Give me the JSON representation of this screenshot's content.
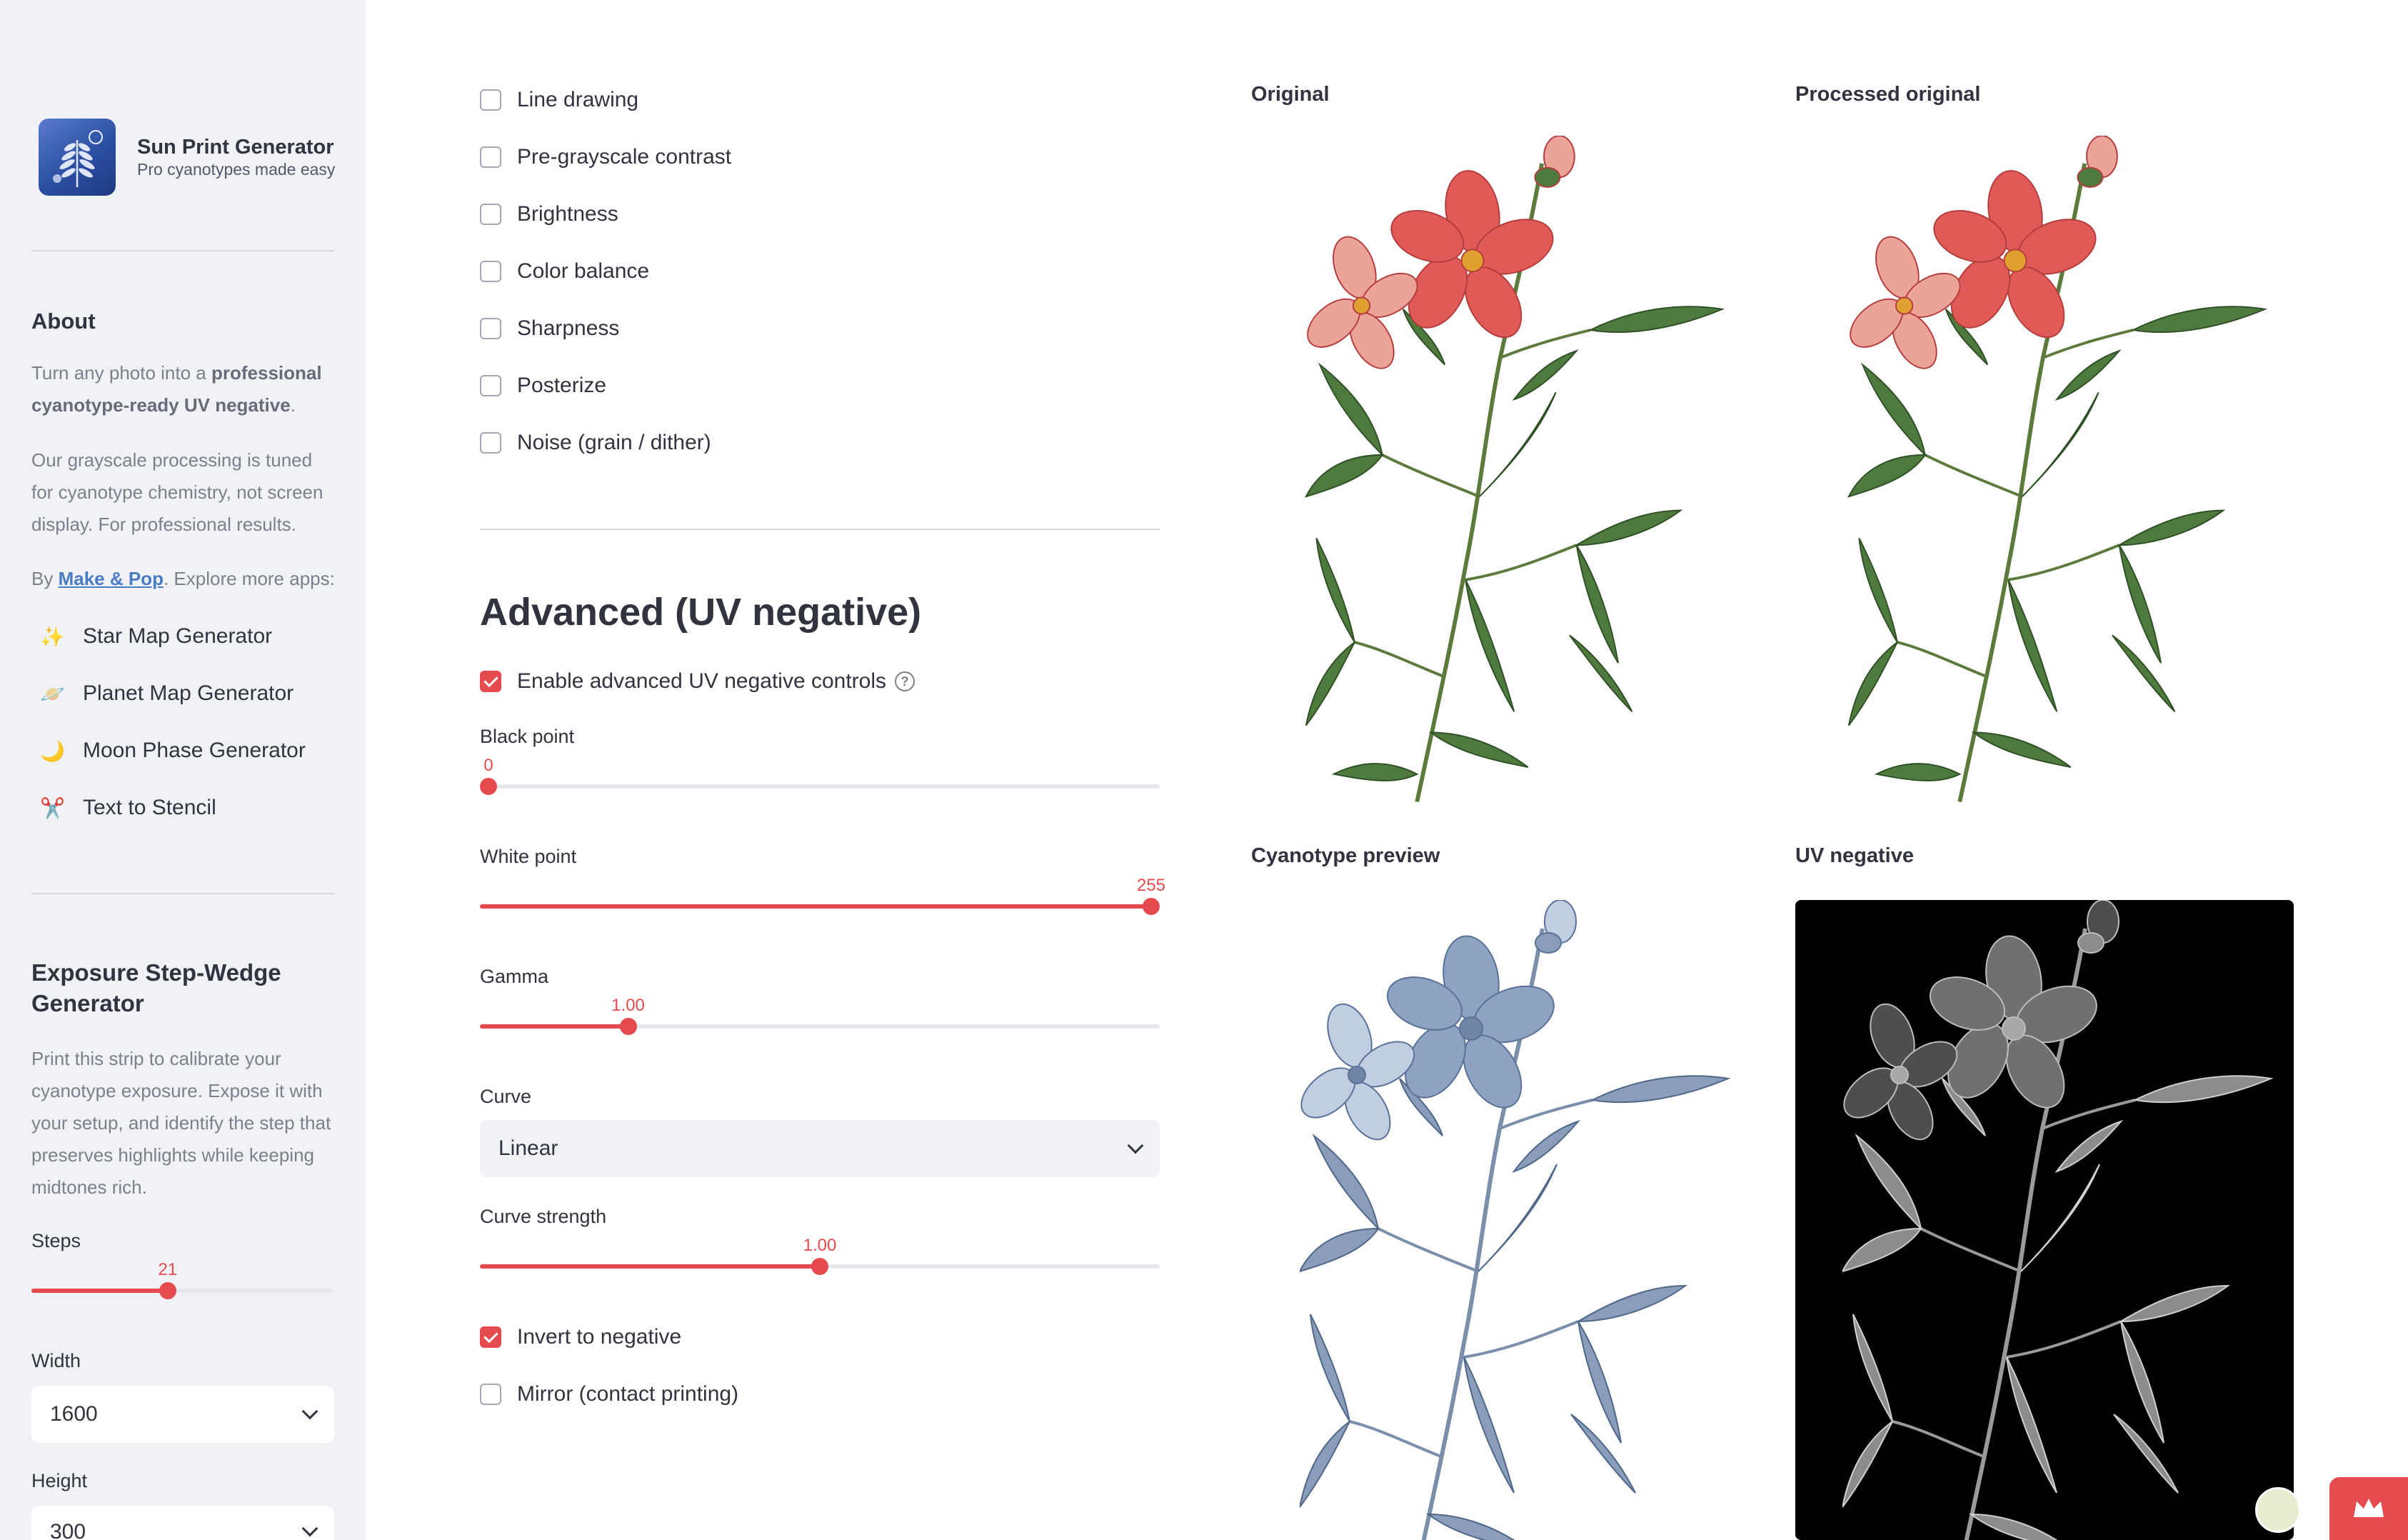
{
  "brand": {
    "title": "Sun Print Generator",
    "subtitle": "Pro cyanotypes made easy"
  },
  "about": {
    "heading": "About",
    "p1_pre": "Turn any photo into a ",
    "p1_bold": "professional cyanotype-ready UV negative",
    "p1_post": ".",
    "p2": "Our grayscale processing is tuned for cyanotype chemistry, not screen display. For professional results.",
    "by_pre": "By ",
    "by_link": "Make & Pop",
    "by_post": ". Explore more apps:"
  },
  "apps": [
    {
      "icon": "✨",
      "label": "Star Map Generator"
    },
    {
      "icon": "🪐",
      "label": "Planet Map Generator"
    },
    {
      "icon": "🌙",
      "label": "Moon Phase Generator"
    },
    {
      "icon": "✂️",
      "label": "Text to Stencil"
    }
  ],
  "stepwedge": {
    "heading": "Exposure Step-Wedge Generator",
    "description": "Print this strip to calibrate your cyanotype exposure. Expose it with your setup, and identify the step that preserves highlights while keeping midtones rich.",
    "steps_label": "Steps",
    "steps_value": "21",
    "steps_fraction": 0.45,
    "width_label": "Width",
    "width_value": "1600",
    "height_label": "Height",
    "height_value": "300"
  },
  "adjustments": [
    {
      "label": "Line drawing",
      "checked": false
    },
    {
      "label": "Pre-grayscale contrast",
      "checked": false
    },
    {
      "label": "Brightness",
      "checked": false
    },
    {
      "label": "Color balance",
      "checked": false
    },
    {
      "label": "Sharpness",
      "checked": false
    },
    {
      "label": "Posterize",
      "checked": false
    },
    {
      "label": "Noise (grain / dither)",
      "checked": false
    }
  ],
  "advanced": {
    "heading": "Advanced (UV negative)",
    "enable_label": "Enable advanced UV negative controls",
    "enable_checked": true,
    "help_glyph": "?",
    "black_point": {
      "label": "Black point",
      "value": "0",
      "fraction": 0.0
    },
    "white_point": {
      "label": "White point",
      "value": "255",
      "fraction": 1.0
    },
    "gamma": {
      "label": "Gamma",
      "value": "1.00",
      "fraction": 0.218
    },
    "curve": {
      "label": "Curve",
      "value": "Linear"
    },
    "curve_strength": {
      "label": "Curve strength",
      "value": "1.00",
      "fraction": 0.5
    },
    "invert_label": "Invert to negative",
    "invert_checked": true,
    "mirror_label": "Mirror (contact printing)",
    "mirror_checked": false
  },
  "previews": {
    "original": "Original",
    "processed": "Processed original",
    "cyanotype": "Cyanotype preview",
    "uv_negative": "UV negative"
  },
  "colors": {
    "accent": "#e54a4e",
    "sidebar_bg": "#f0f2f6",
    "text": "#31333f",
    "cyan_tint": "#7f95b3"
  }
}
